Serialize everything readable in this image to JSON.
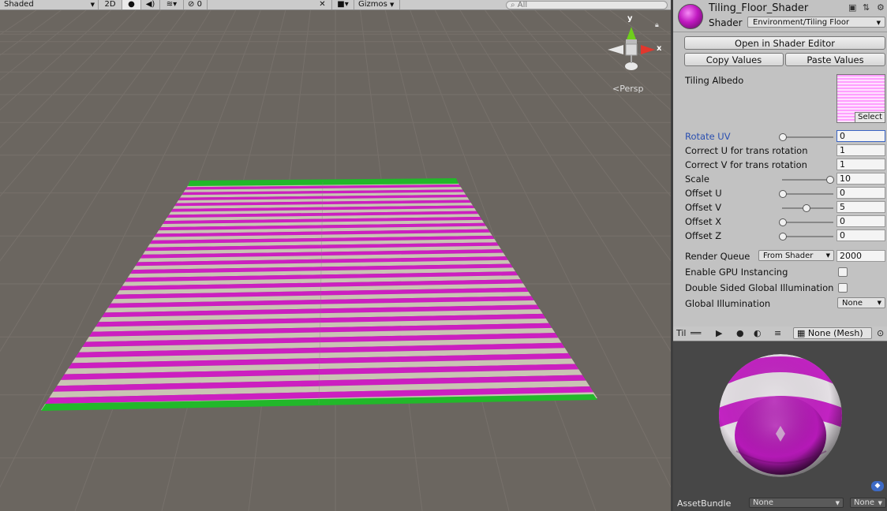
{
  "scene": {
    "toolbar": {
      "shading_mode": "Shaded",
      "mode_2d": "2D",
      "lighting_icon": "lightbulb-icon",
      "audio_icon": "speaker-icon",
      "effects_icon": "layers-icon",
      "hidden_count": "0",
      "gizmos_label": "Gizmos",
      "search_placeholder": "All"
    },
    "gizmo": {
      "y_label": "y",
      "x_label": "x",
      "projection": "Persp"
    },
    "colors": {
      "background": "#6b6660",
      "stripe_a": "#cc1fc0",
      "stripe_b": "#c9c4b4",
      "edge": "#22b82a"
    }
  },
  "inspector": {
    "material_name": "Tiling_Floor_Shader",
    "shader_label": "Shader",
    "shader_value": "Environment/Tiling Floor",
    "open_shader_editor": "Open in Shader Editor",
    "copy_values": "Copy Values",
    "paste_values": "Paste Values",
    "albedo_label": "Tiling Albedo",
    "albedo_select": "Select",
    "properties": [
      {
        "label": "Rotate UV",
        "value": "0",
        "slider": 0.0,
        "active": true
      },
      {
        "label": "Correct U for trans rotation",
        "value": "1"
      },
      {
        "label": "Correct V for trans rotation",
        "value": "1"
      },
      {
        "label": "Scale",
        "value": "10",
        "slider": 1.0
      },
      {
        "label": "Offset U",
        "value": "0",
        "slider": 0.0
      },
      {
        "label": "Offset V",
        "value": "5",
        "slider": 0.5
      },
      {
        "label": "Offset X",
        "value": "0",
        "slider": 0.0
      },
      {
        "label": "Offset Z",
        "value": "0",
        "slider": 0.0
      }
    ],
    "render_queue_label": "Render Queue",
    "render_queue_mode": "From Shader",
    "render_queue_value": "2000",
    "gpu_instancing_label": "Enable GPU Instancing",
    "double_sided_label": "Double Sided Global Illumination",
    "gi_label": "Global Illumination",
    "gi_value": "None"
  },
  "preview": {
    "title": "Til",
    "mesh": "None (Mesh)",
    "asset_bundle_label": "AssetBundle",
    "asset_bundle_value": "None",
    "variant_value": "None"
  }
}
